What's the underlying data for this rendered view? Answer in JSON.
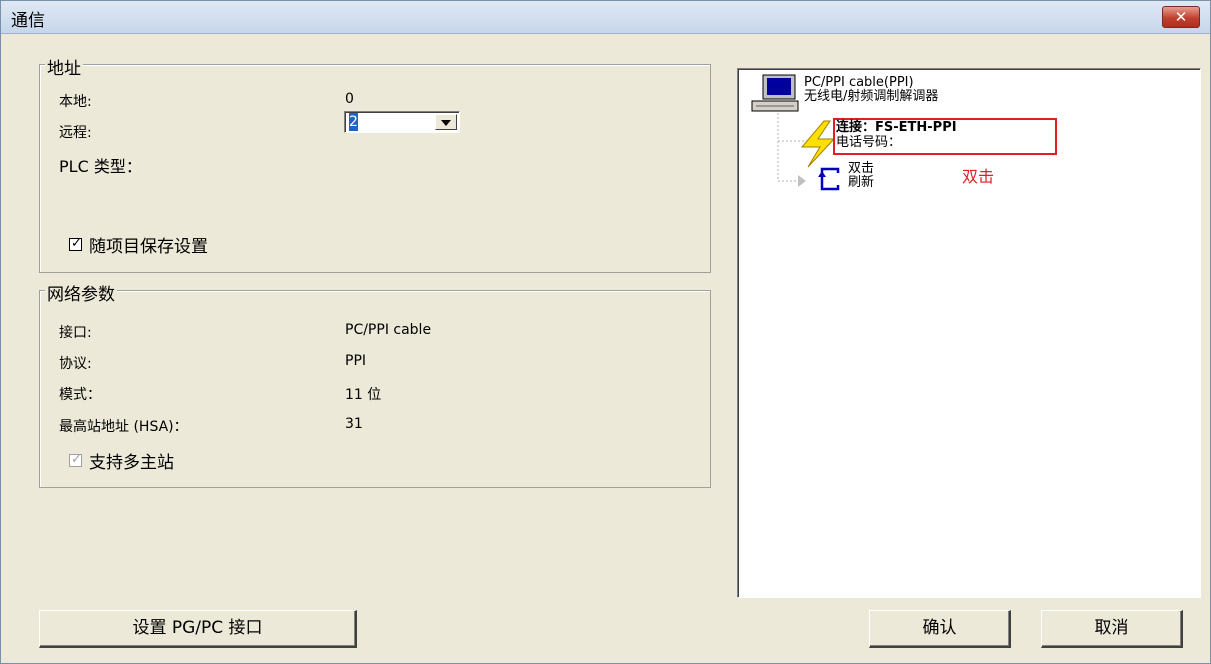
{
  "window": {
    "title": "通信"
  },
  "address_group": {
    "title": "地址",
    "local_label": "本地:",
    "local_value": "0",
    "remote_label": "远程:",
    "remote_value": "2",
    "plc_type_label": "PLC 类型：",
    "save_with_project_label": "随项目保存设置",
    "save_with_project_checked": true
  },
  "network_group": {
    "title": "网络参数",
    "interface_label": "接口:",
    "interface_value": "PC/PPI cable",
    "protocol_label": "协议:",
    "protocol_value": "PPI",
    "mode_label": "模式：",
    "mode_value": "11 位",
    "hsa_label": "最高站地址 (HSA)：",
    "hsa_value": "31",
    "multi_master_label": "支持多主站",
    "multi_master_checked": true
  },
  "tree": {
    "device_line1": "PC/PPI cable(PPI)",
    "device_line2": "无线电/射频调制解调器",
    "connect_line": "连接：FS-ETH-PPI",
    "phone_line": "电话号码：",
    "refresh_line1": "双击",
    "refresh_line2": "刷新",
    "annotation": "双击"
  },
  "buttons": {
    "set_pgpc": "设置 PG/PC 接口",
    "ok": "确认",
    "cancel": "取消"
  },
  "colors": {
    "highlight": "#e02020",
    "selection": "#1e64c8"
  }
}
